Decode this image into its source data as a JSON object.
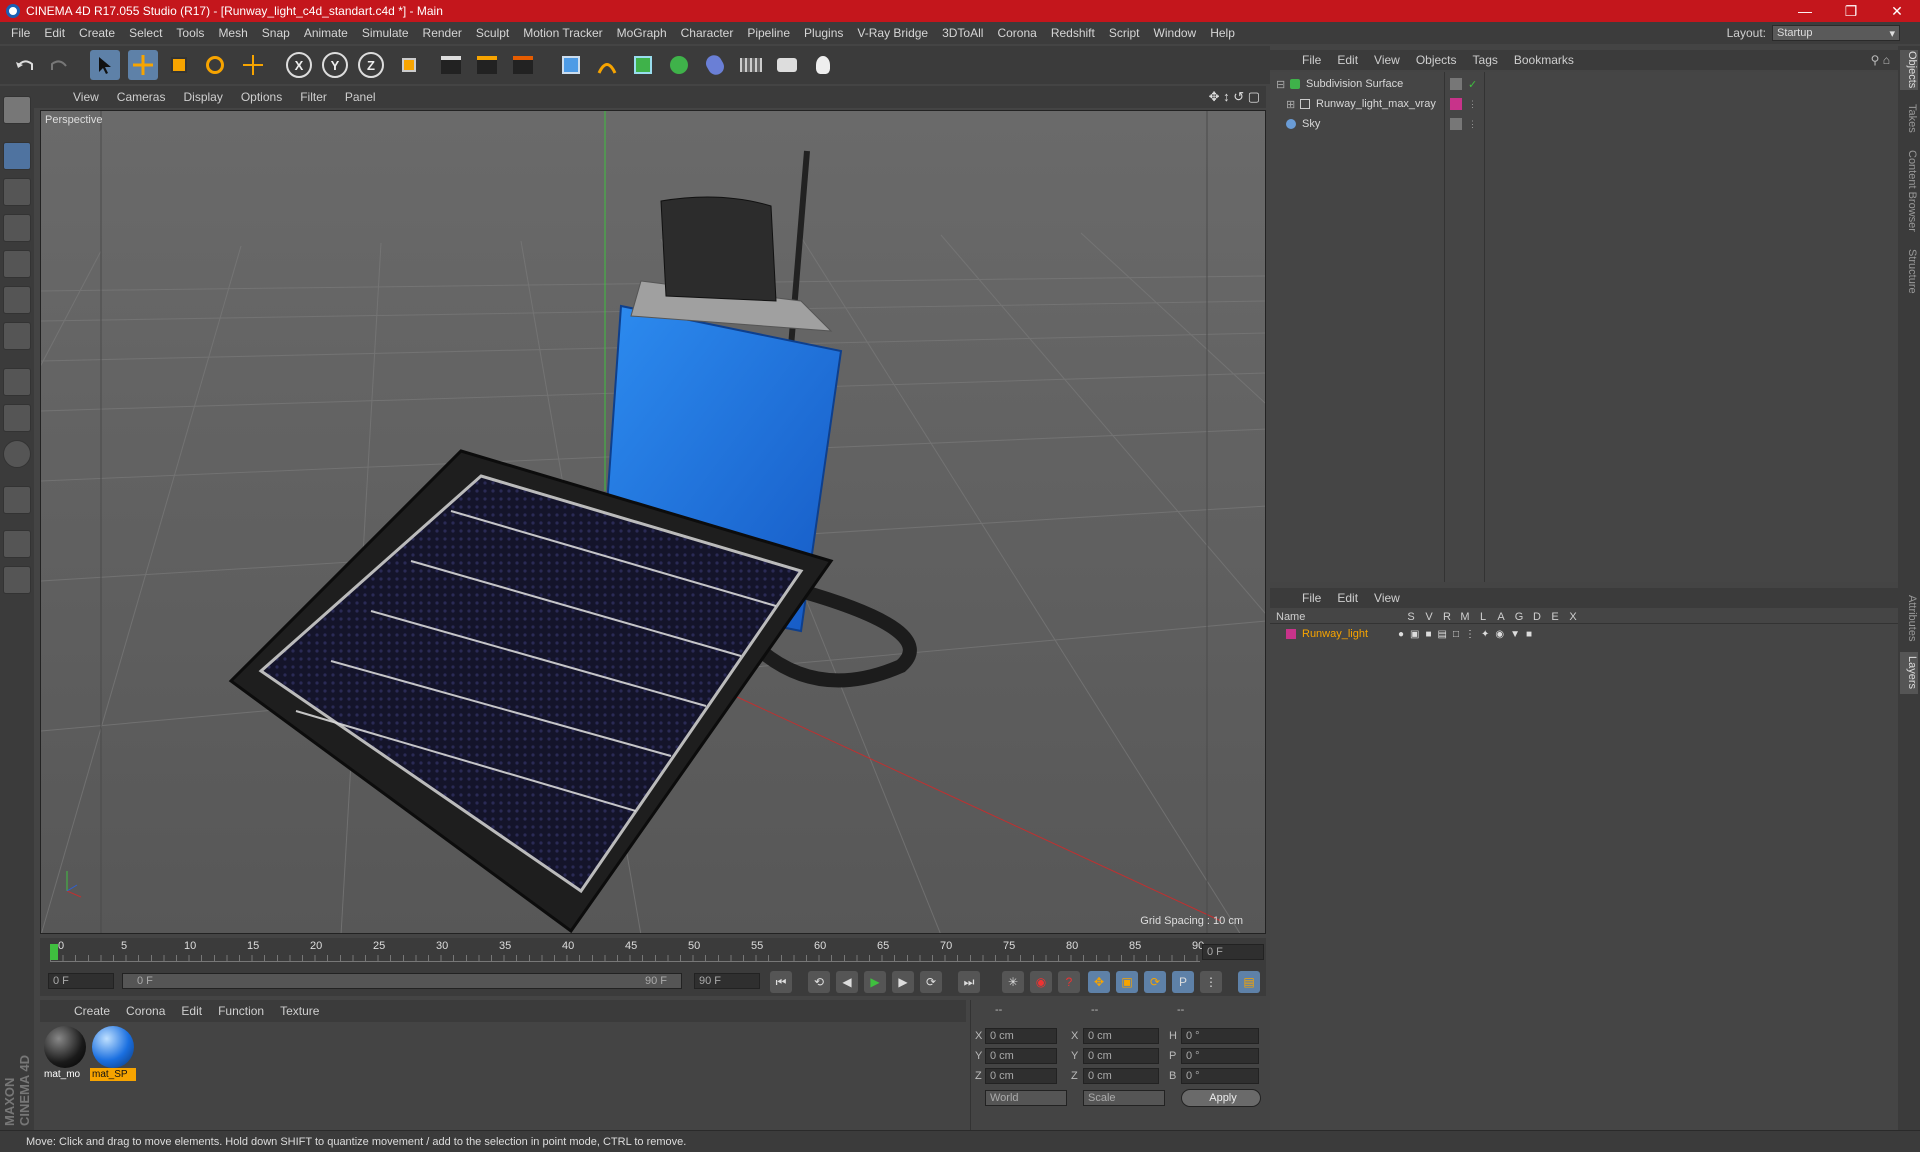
{
  "window": {
    "title": "CINEMA 4D R17.055 Studio (R17) - [Runway_light_c4d_standart.c4d *] - Main",
    "minimize_icon": "minimize-icon",
    "maximize_icon": "maximize-icon",
    "close_icon": "close-icon"
  },
  "menu": [
    "File",
    "Edit",
    "Create",
    "Select",
    "Tools",
    "Mesh",
    "Snap",
    "Animate",
    "Simulate",
    "Render",
    "Sculpt",
    "Motion Tracker",
    "MoGraph",
    "Character",
    "Pipeline",
    "Plugins",
    "V-Ray Bridge",
    "3DToAll",
    "Corona",
    "Redshift",
    "Script",
    "Window",
    "Help"
  ],
  "layout": {
    "label": "Layout:",
    "value": "Startup"
  },
  "toolbar": {
    "axis_x": "X",
    "axis_y": "Y",
    "axis_z": "Z"
  },
  "viewport": {
    "menu": [
      "View",
      "Cameras",
      "Display",
      "Options",
      "Filter",
      "Panel"
    ],
    "camera_label": "Perspective",
    "grid_spacing": "Grid Spacing : 10 cm",
    "accent_blue": "#1e73e8"
  },
  "timeline": {
    "ticks": [
      "0",
      "5",
      "10",
      "15",
      "20",
      "25",
      "30",
      "35",
      "40",
      "45",
      "50",
      "55",
      "60",
      "65",
      "70",
      "75",
      "80",
      "85",
      "90"
    ],
    "current_frame_field": "0 F",
    "start_field": "0 F",
    "range_left": "0 F",
    "range_right": "90 F",
    "end_field": "90 F"
  },
  "materials": {
    "menu": [
      "Create",
      "Corona",
      "Edit",
      "Function",
      "Texture"
    ],
    "items": [
      {
        "name": "mat_mo",
        "color": "#1a1a1a"
      },
      {
        "name": "mat_SP",
        "color": "#1a6fe0"
      }
    ]
  },
  "coordinates": {
    "header": [
      "--",
      "--",
      "--"
    ],
    "rows": [
      {
        "a": "X",
        "av": "0 cm",
        "b": "X",
        "bv": "0 cm",
        "c": "H",
        "cv": "0 °"
      },
      {
        "a": "Y",
        "av": "0 cm",
        "b": "Y",
        "bv": "0 cm",
        "c": "P",
        "cv": "0 °"
      },
      {
        "a": "Z",
        "av": "0 cm",
        "b": "Z",
        "bv": "0 cm",
        "c": "B",
        "cv": "0 °"
      }
    ],
    "mode_world": "World",
    "mode_scale": "Scale",
    "apply": "Apply"
  },
  "objects_panel": {
    "menu": [
      "File",
      "Edit",
      "View",
      "Objects",
      "Tags",
      "Bookmarks"
    ],
    "items": [
      {
        "name": "Subdivision Surface"
      },
      {
        "name": "Runway_light_max_vray"
      },
      {
        "name": "Sky"
      }
    ]
  },
  "layers_panel": {
    "menu": [
      "File",
      "Edit",
      "View"
    ],
    "col_name": "Name",
    "cols": [
      "S",
      "V",
      "R",
      "M",
      "L",
      "A",
      "G",
      "D",
      "E",
      "X"
    ],
    "layer": {
      "name": "Runway_light",
      "color": "#c8338a"
    }
  },
  "side_tabs": [
    "Objects",
    "Takes",
    "Content Browser",
    "Structure",
    "Attributes",
    "Layers"
  ],
  "branding": "MAXON CINEMA 4D",
  "status": "Move: Click and drag to move elements. Hold down SHIFT to quantize movement / add to the selection in point mode, CTRL to remove."
}
